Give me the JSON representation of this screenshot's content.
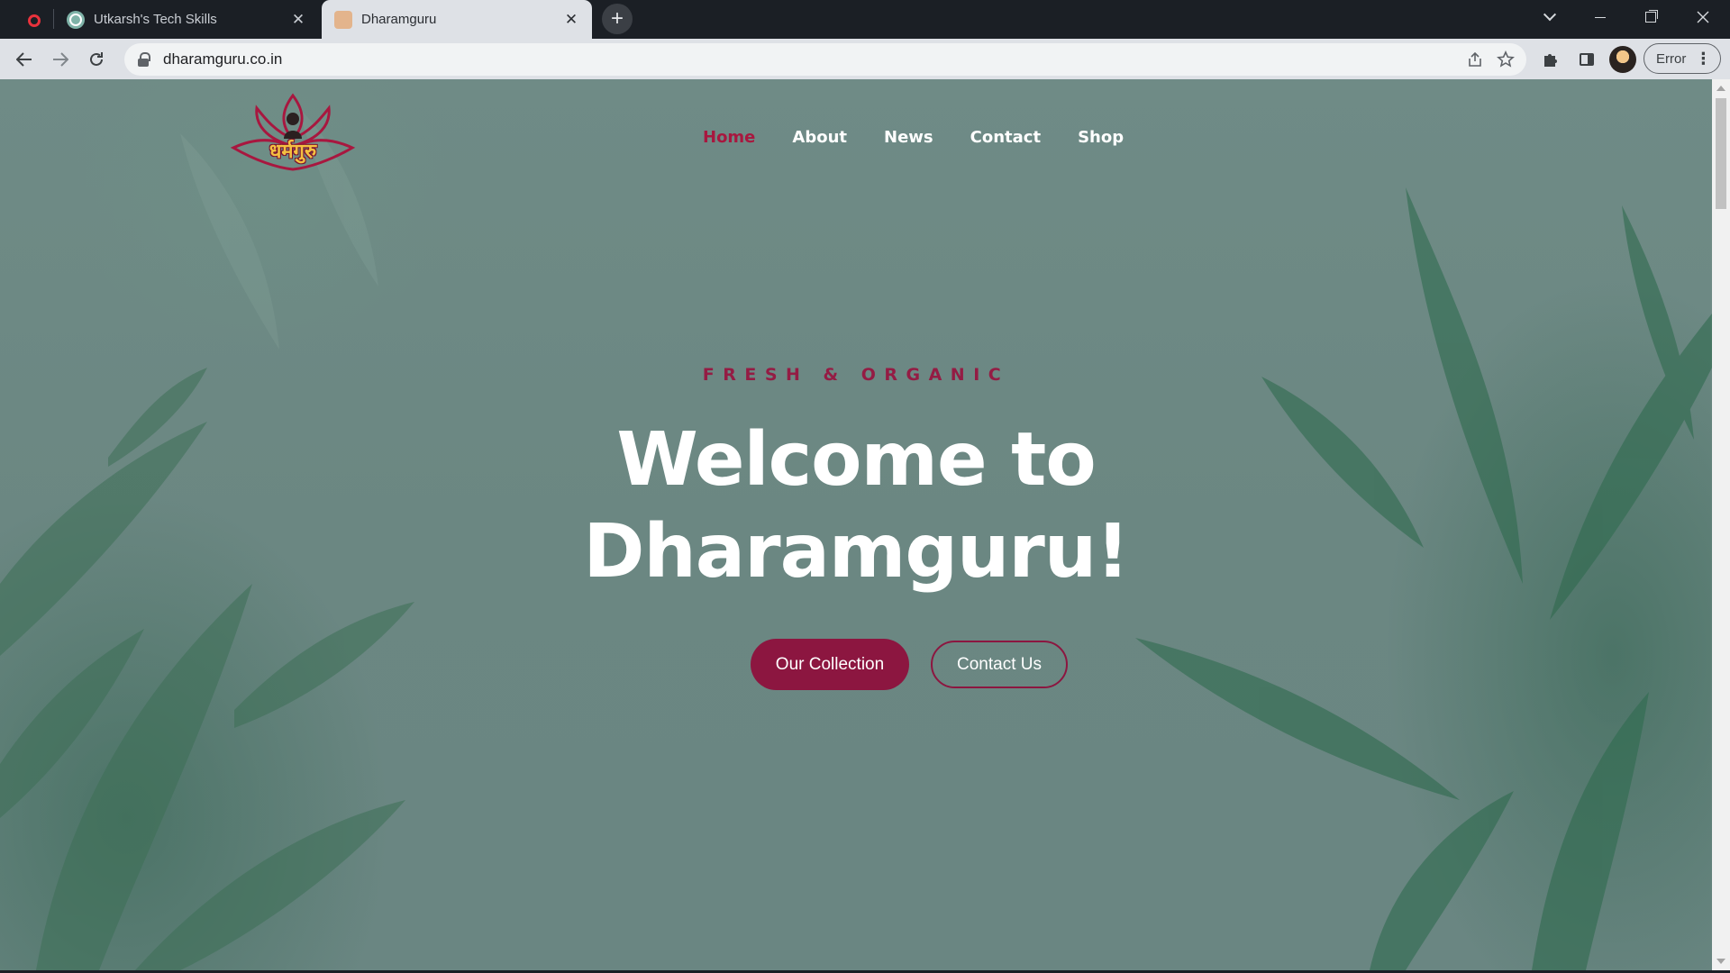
{
  "browser": {
    "tabs": [
      {
        "title": "Utkarsh's Tech Skills",
        "favicon": "chatgpt-icon",
        "active": false
      },
      {
        "title": "Dharamguru",
        "favicon": "dharamguru-favicon",
        "active": true
      }
    ],
    "new_tab_symbol": "+",
    "close_symbol": "✕",
    "url": "dharamguru.co.in",
    "profile_error_label": "Error",
    "menu_symbol": "⋮"
  },
  "site": {
    "logo_text": "धर्मगुरु",
    "nav": [
      {
        "label": "Home",
        "active": true
      },
      {
        "label": "About",
        "active": false
      },
      {
        "label": "News",
        "active": false
      },
      {
        "label": "Contact",
        "active": false
      },
      {
        "label": "Shop",
        "active": false
      }
    ],
    "hero": {
      "subtitle": "FRESH & ORGANIC",
      "title_line1": "Welcome to",
      "title_line2": "Dharamguru!",
      "primary_button": "Our Collection",
      "secondary_button": "Contact Us"
    }
  },
  "colors": {
    "accent": "#8c1640",
    "active_nav": "#a8173f",
    "subtitle": "#941c44",
    "background": "#6c8883"
  }
}
